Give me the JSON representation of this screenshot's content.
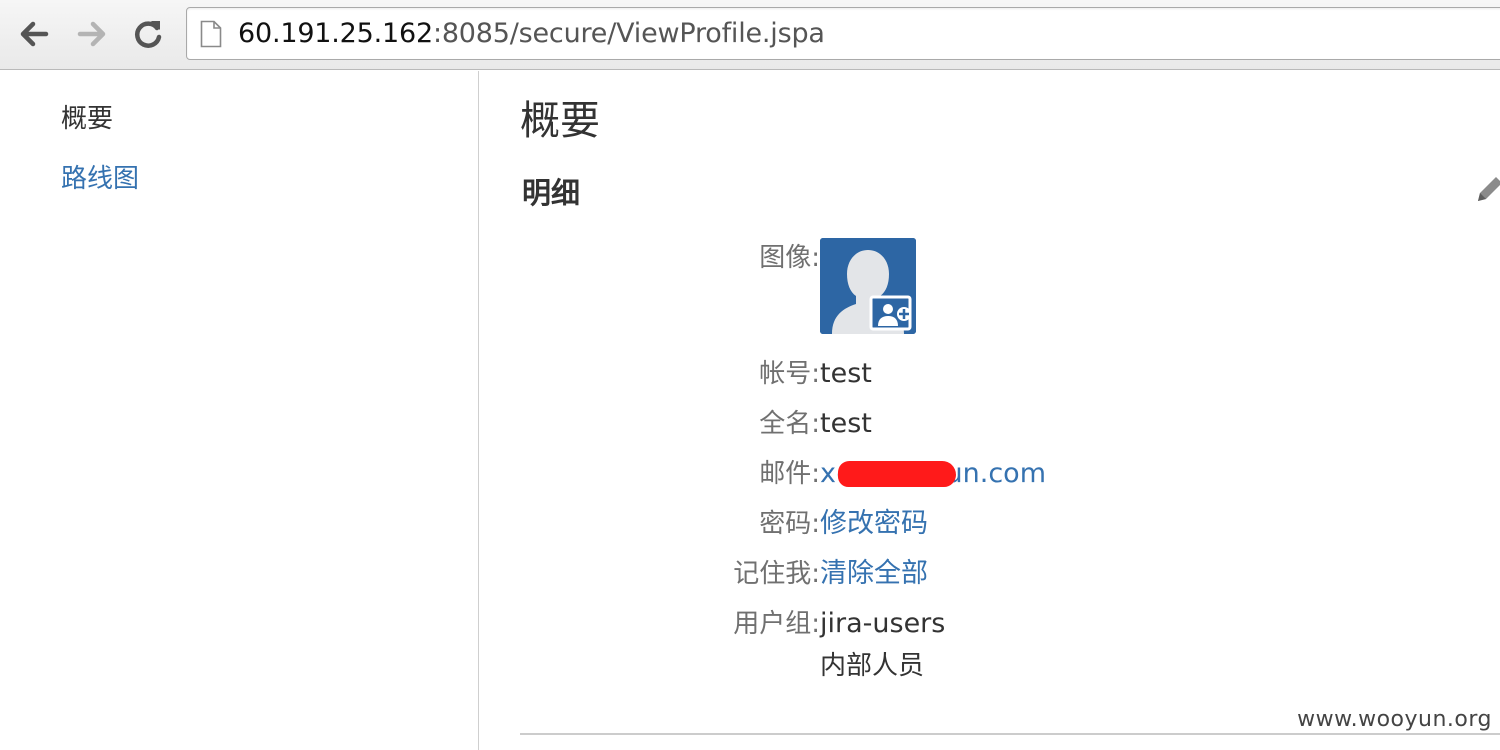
{
  "browser": {
    "url_host": "60.191.25.162",
    "url_rest": ":8085/secure/ViewProfile.jspa"
  },
  "sidebar": {
    "items": [
      {
        "label": "概要"
      },
      {
        "label": "路线图"
      }
    ]
  },
  "main": {
    "title": "概要",
    "section_title": "明细",
    "fields": {
      "avatar_label": "图像:",
      "username_label": "帐号:",
      "username_value": "test",
      "fullname_label": "全名:",
      "fullname_value": "test",
      "email_label": "邮件:",
      "email_value": "x@hundsun.com",
      "password_label": "密码:",
      "password_link": "修改密码",
      "remember_label": "记住我:",
      "remember_link": "清除全部",
      "groups_label": "用户组:",
      "groups": [
        "jira-users",
        "内部人员"
      ]
    }
  },
  "watermark": "www.wooyun.org",
  "colors": {
    "link": "#3572b0",
    "redaction": "#ff1a1a"
  },
  "icons": [
    "back-arrow-icon",
    "forward-arrow-icon",
    "reload-icon",
    "page-icon",
    "pencil-icon",
    "avatar-icon"
  ]
}
